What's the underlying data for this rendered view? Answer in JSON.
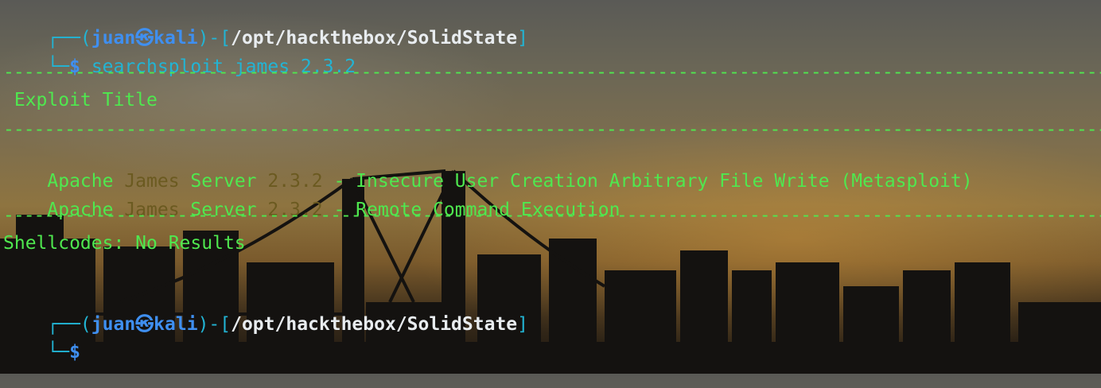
{
  "prompt1": {
    "corner_top": "┌──(",
    "user": "juan",
    "at_symbol": "㉿",
    "host": "kali",
    "mid": ")-[",
    "path": "/opt/hackthebox/SolidState",
    "close": "]",
    "corner_bottom": "└─",
    "dollar": "$",
    "command": "searchsploit james 2.3.2"
  },
  "separator": "------------------------------------------------------------------------------------------------------------------------------------------------------------",
  "header": {
    "exploit_title": " Exploit Title"
  },
  "results": [
    {
      "prefix": "Apache ",
      "match1": "James",
      "mid": " Server ",
      "match2": "2.3.2",
      "title": " - Insecure User Creation Arbitrary File Write (Metasploit)"
    },
    {
      "prefix": "Apache ",
      "match1": "James",
      "mid": " Server ",
      "match2": "2.3.2",
      "title": " - Remote Command Execution"
    }
  ],
  "shellcodes": "Shellcodes: No Results",
  "prompt2": {
    "corner_top": "┌──(",
    "user": "juan",
    "at_symbol": "㉿",
    "host": "kali",
    "mid": ")-[",
    "path": "/opt/hackthebox/SolidState",
    "close": "]",
    "corner_bottom": "└─",
    "dollar": "$"
  },
  "colors": {
    "prompt_frame": "#22b4d4",
    "user_host": "#3f8ff0",
    "path": "#e8ecef",
    "output": "#4fe84f",
    "match_highlight": "#6b5a20"
  }
}
